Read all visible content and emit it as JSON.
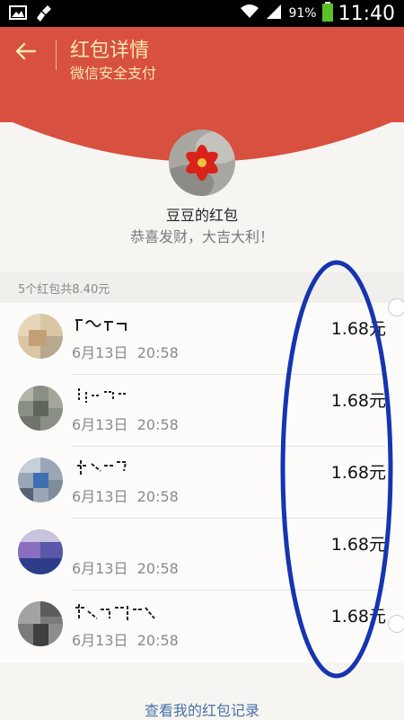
{
  "status_bar": {
    "battery_percent": "91%",
    "time": "11:40",
    "icons": [
      "image-icon",
      "broom-icon",
      "wifi-icon",
      "signal-icon",
      "battery-icon"
    ]
  },
  "header": {
    "title": "红包详情",
    "subtitle": "微信安全支付",
    "back_icon": "back-arrow-icon"
  },
  "packet": {
    "sender": "豆豆的红包",
    "wish": "恭喜发财，大吉大利！"
  },
  "summary": "5个红包共8.40元",
  "recipients": [
    {
      "name": "",
      "time": "6月13日  20:58",
      "amount": "1.68元"
    },
    {
      "name": "",
      "time": "6月13日  20:58",
      "amount": "1.68元"
    },
    {
      "name": "",
      "time": "6月13日  20:58",
      "amount": "1.68元"
    },
    {
      "name": "",
      "time": "6月13日  20:58",
      "amount": "1.68元"
    },
    {
      "name": "",
      "time": "6月13日  20:58",
      "amount": "1.68元"
    }
  ],
  "footer": {
    "link": "查看我的红包记录"
  },
  "colors": {
    "header_red": "#d8503f",
    "header_text": "#f8e7b0",
    "annotation_blue": "#1535b0",
    "link_blue": "#4a72a6"
  }
}
